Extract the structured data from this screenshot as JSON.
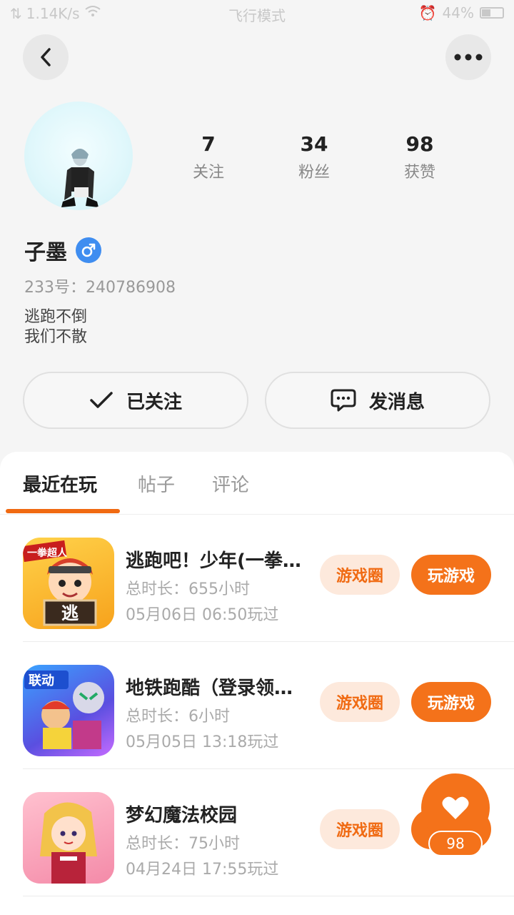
{
  "status_bar": {
    "speed": "1.14K/s",
    "mode": "飞行模式",
    "battery": "44%",
    "battery_level": 0.44
  },
  "profile": {
    "stats": [
      {
        "value": "7",
        "label": "关注"
      },
      {
        "value": "34",
        "label": "粉丝"
      },
      {
        "value": "98",
        "label": "获赞"
      }
    ],
    "name": "子墨",
    "gender_symbol": "♂",
    "uid": "233号：240786908",
    "bio_line1": "逃跑不倒",
    "bio_line2": "我们不散"
  },
  "actions": {
    "follow_label": "已关注",
    "message_label": "发消息"
  },
  "tabs": [
    {
      "label": "最近在玩",
      "active": true
    },
    {
      "label": "帖子",
      "active": false
    },
    {
      "label": "评论",
      "active": false
    }
  ],
  "games": [
    {
      "title": "逃跑吧！少年(一拳…",
      "duration": "总时长：655小时",
      "last_played": "05月06日 06:50玩过",
      "circle_label": "游戏圈",
      "play_label": "玩游戏",
      "icon_badge": "一拳超人",
      "icon_char": "逃"
    },
    {
      "title": "地铁跑酷（登录领…",
      "duration": "总时长：6小时",
      "last_played": "05月05日 13:18玩过",
      "circle_label": "游戏圈",
      "play_label": "玩游戏",
      "icon_badge": "联动"
    },
    {
      "title": "梦幻魔法校园",
      "duration": "总时长：75小时",
      "last_played": "04月24日 17:55玩过",
      "circle_label": "游戏圈",
      "play_label": "玩"
    }
  ],
  "like_fab": {
    "count": "98"
  },
  "colors": {
    "accent": "#f4721a",
    "accent_soft": "#fde9dc",
    "gender_blue": "#3f8df0"
  }
}
